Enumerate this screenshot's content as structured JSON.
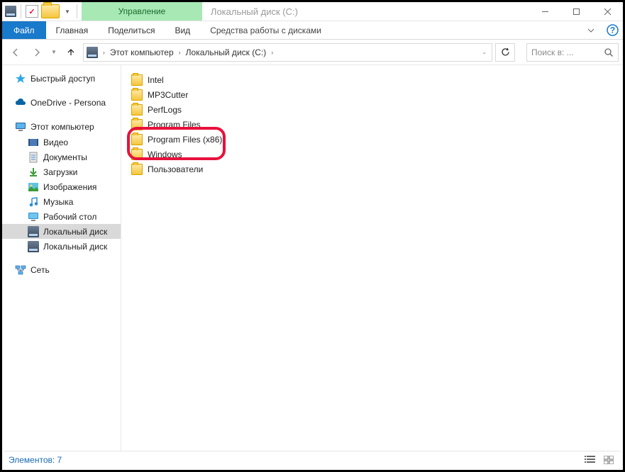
{
  "titlebar": {
    "contextual_group": "Управление",
    "window_title": "Локальный диск (C:)"
  },
  "ribbon": {
    "file": "Файл",
    "tabs": [
      "Главная",
      "Поделиться",
      "Вид"
    ],
    "contextual_tab": "Средства работы с дисками"
  },
  "address": {
    "crumbs": [
      "Этот компьютер",
      "Локальный диск (C:)"
    ],
    "search_placeholder": "Поиск в: ..."
  },
  "tree": {
    "quick_access": "Быстрый доступ",
    "onedrive": "OneDrive - Persona",
    "this_pc": "Этот компьютер",
    "children": [
      "Видео",
      "Документы",
      "Загрузки",
      "Изображения",
      "Музыка",
      "Рабочий стол",
      "Локальный диск",
      "Локальный диск"
    ],
    "network": "Сеть",
    "selected_index": 6
  },
  "folders": [
    "Intel",
    "MP3Cutter",
    "PerfLogs",
    "Program Files",
    "Program Files (x86)",
    "Windows",
    "Пользователи"
  ],
  "highlight_folders": [
    3,
    4
  ],
  "status": {
    "count_label": "Элементов: 7"
  }
}
